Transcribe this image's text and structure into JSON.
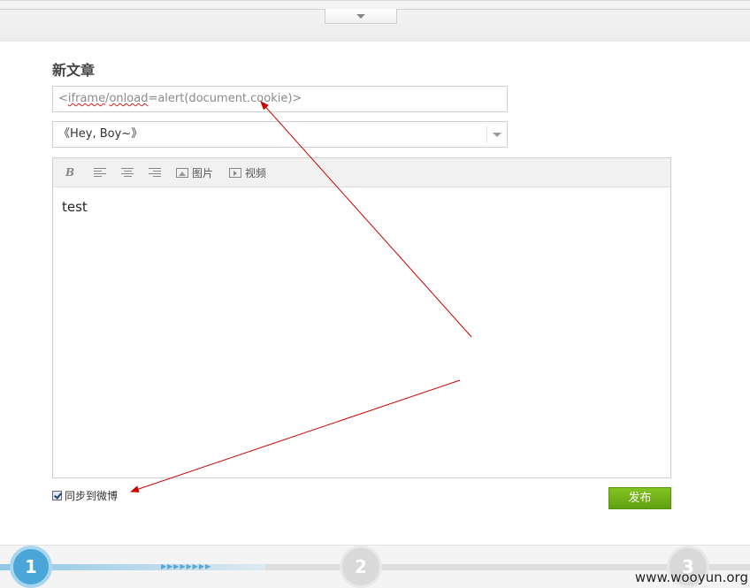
{
  "form": {
    "heading": "新文章",
    "title_before": "<",
    "title_word1": "iframe",
    "title_slash": "/",
    "title_word2": "onload",
    "title_after": "=alert(document.cookie)>",
    "category_selected": "《Hey, Boy~》"
  },
  "toolbar": {
    "bold_label": "B",
    "image_label": "图片",
    "video_label": "视频"
  },
  "editor": {
    "content": "test"
  },
  "sync": {
    "label": "同步到微博",
    "checked": true
  },
  "publish": {
    "label": "发布"
  },
  "steps": {
    "step1": "1",
    "step2": "2",
    "step3": "3"
  },
  "watermark": "www.wooyun.org",
  "colors": {
    "accent_green": "#6aad17",
    "step_blue": "#4aa6d8",
    "annotation_red": "#cc0000"
  }
}
